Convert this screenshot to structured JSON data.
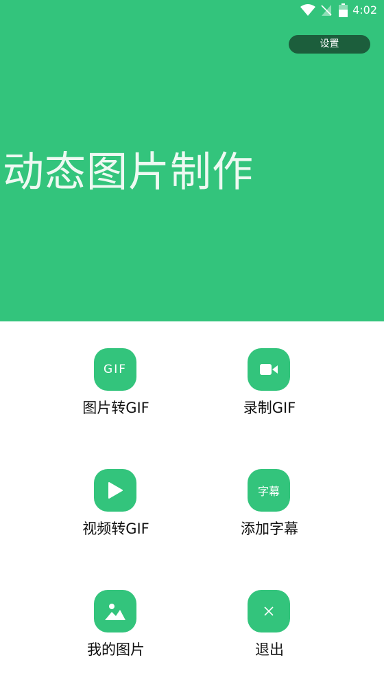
{
  "status_bar": {
    "time": "4:02",
    "icons": [
      "wifi-icon",
      "signal-off-icon",
      "battery-icon"
    ]
  },
  "header": {
    "settings_label": "设置",
    "title": "动态图片制作"
  },
  "menu": [
    {
      "label": "图片转GIF",
      "icon": "gif-icon",
      "icon_text": "GIF"
    },
    {
      "label": "录制GIF",
      "icon": "video-camera-icon"
    },
    {
      "label": "视频转GIF",
      "icon": "play-icon"
    },
    {
      "label": "添加字幕",
      "icon": "subtitle-icon",
      "icon_text": "字幕"
    },
    {
      "label": "我的图片",
      "icon": "image-icon"
    },
    {
      "label": "退出",
      "icon": "close-icon"
    }
  ],
  "colors": {
    "brand": "#33c47c",
    "settings_button": "#1c5e3c",
    "text": "#111111"
  }
}
